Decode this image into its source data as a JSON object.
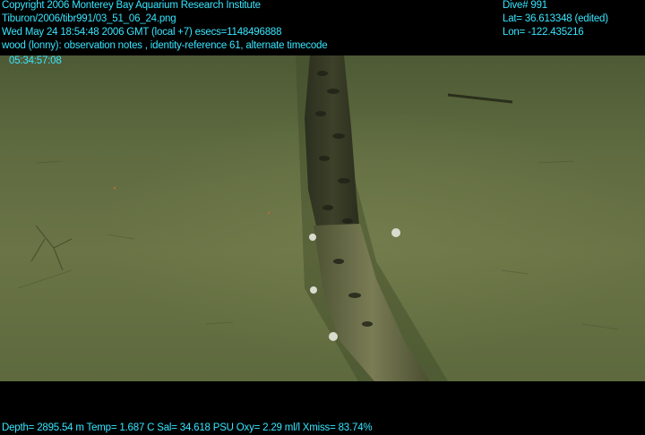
{
  "overlay": {
    "copyright": "Copyright 2006 Monterey Bay Aquarium Research Institute",
    "filename": "Tiburon/2006/tibr991/03_51_06_24.png",
    "datetime": "Wed May 24 18:54:48 2006 GMT (local +7)  esecs=1148496888",
    "annotation": "wood (lonny): observation notes , identity-reference 61, alternate timecode",
    "timecode": "05:34:57:08",
    "dive": "Dive# 991",
    "lat": "Lat= 36.613348 (edited)",
    "lon": "Lon= -122.435216",
    "sensors": "Depth= 2895.54 m  Temp= 1.687 C  Sal= 34.618 PSU  Oxy= 2.29 ml/l  Xmiss= 83.74%"
  },
  "colors": {
    "overlay_text": "#37e6ff",
    "seafloor": "#66724a",
    "log": "#2f3322",
    "background": "#000000"
  }
}
